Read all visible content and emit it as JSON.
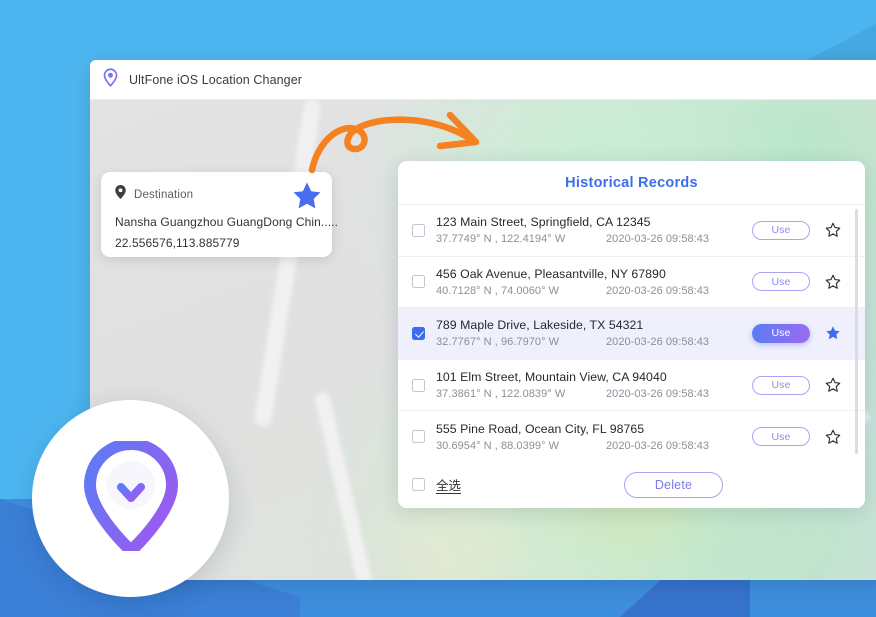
{
  "window": {
    "title": "UltFone iOS Location Changer",
    "logo_icon": "location-pin-logo-icon"
  },
  "destination_card": {
    "pin_icon": "map-pin-icon",
    "label": "Destination",
    "address": "Nansha  Guangzhou  GuangDong Chin.....",
    "coordinates": "22.556576,113.885779",
    "star_icon": "star-filled-icon",
    "star_color": "#4a6cf0"
  },
  "annotation": {
    "arrow_icon": "curved-arrow-icon",
    "arrow_color": "#f58220"
  },
  "records_panel": {
    "title": "Historical Records",
    "title_color": "#3b6df0",
    "use_label": "Use",
    "star_outline_icon": "star-outline-icon",
    "star_filled_icon": "star-filled-icon",
    "rows": [
      {
        "address": "123 Main Street, Springfield, CA 12345",
        "coordinates": "37.7749° N ,  122.4194° W",
        "timestamp": "2020-03-26 09:58:43",
        "checked": false,
        "favorited": false,
        "active": false
      },
      {
        "address": "456 Oak Avenue, Pleasantville, NY 67890",
        "coordinates": "40.7128° N ,  74.0060° W",
        "timestamp": "2020-03-26 09:58:43",
        "checked": false,
        "favorited": false,
        "active": false
      },
      {
        "address": "789 Maple Drive, Lakeside, TX 54321",
        "coordinates": "32.7767° N ,  96.7970° W",
        "timestamp": "2020-03-26 09:58:43",
        "checked": true,
        "favorited": true,
        "active": true
      },
      {
        "address": "101 Elm Street, Mountain View, CA 94040",
        "coordinates": "37.3861° N ,  122.0839° W",
        "timestamp": "2020-03-26 09:58:43",
        "checked": false,
        "favorited": false,
        "active": false
      },
      {
        "address": "555 Pine Road, Ocean City, FL 98765",
        "coordinates": "30.6954° N ,  88.0399° W",
        "timestamp": "2020-03-26 09:58:43",
        "checked": false,
        "favorited": false,
        "active": false
      }
    ],
    "footer": {
      "select_all_label": "全选",
      "select_all_checked": false,
      "delete_label": "Delete"
    }
  },
  "logo_badge": {
    "icon": "pin-download-logo-icon",
    "gradient_from": "#5b7cf5",
    "gradient_to": "#9b5bf0"
  }
}
